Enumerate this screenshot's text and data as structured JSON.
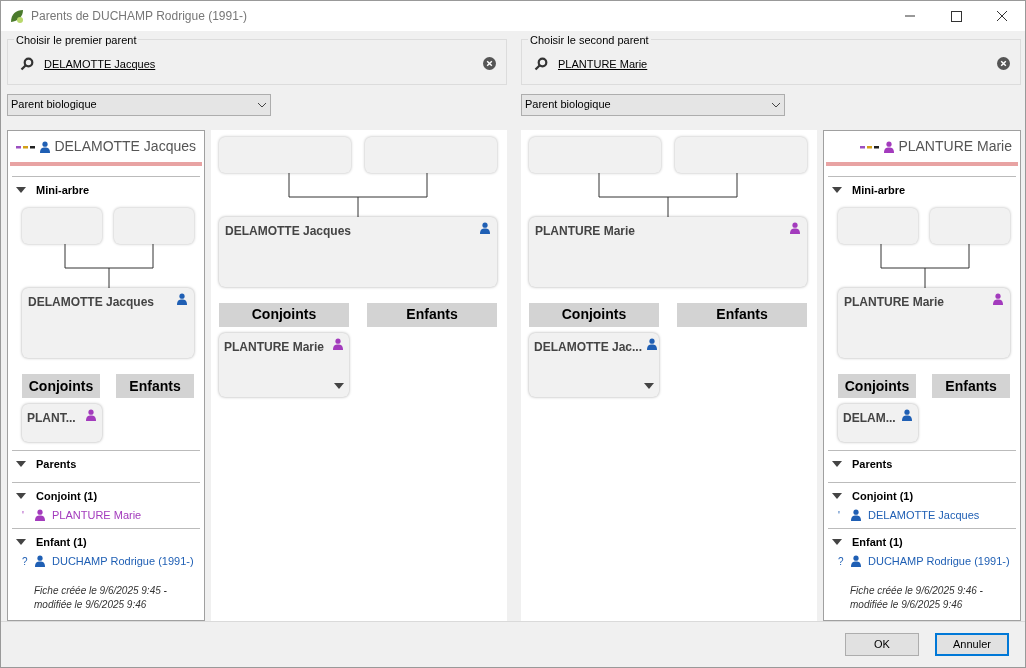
{
  "window": {
    "title": "Parents de DUCHAMP Rodrigue (1991-)"
  },
  "parents": [
    {
      "kind": "card-first",
      "chooser_label": "Choisir le premier parent",
      "selected_name": "DELAMOTTE Jacques",
      "relation": "Parent biologique",
      "tree": {
        "person": {
          "name": "DELAMOTTE Jacques",
          "color": "#1f5fb4"
        },
        "conjoints_label": "Conjoints",
        "enfants_label": "Enfants",
        "spouse": {
          "name": "PLANTURE Marie",
          "color": "#a33bbd"
        }
      },
      "card": {
        "name": "DELAMOTTE Jacques",
        "color": "#1f5fb4",
        "mini_tree_title": "Mini-arbre",
        "mini_tree": {
          "person": {
            "name": "DELAMOTTE Jacques",
            "color": "#1f5fb4"
          },
          "conjoints_label": "Conjoints",
          "enfants_label": "Enfants",
          "spouse": {
            "name": "PLANT...",
            "color": "#a33bbd"
          }
        },
        "parents_title": "Parents",
        "lists": [
          {
            "title": "Conjoint (1)",
            "items": [
              {
                "marker": "'",
                "name": "PLANTURE Marie",
                "color": "#a33bbd"
              }
            ]
          },
          {
            "title": "Enfant (1)",
            "items": [
              {
                "marker": "?",
                "name": "DUCHAMP Rodrigue (1991-)",
                "color": "#1f5fb4"
              }
            ]
          }
        ],
        "note": "Fiche créée le 9/6/2025 9:45 - modifiée le 9/6/2025 9:46"
      }
    },
    {
      "kind": "card-last",
      "chooser_label": "Choisir le second parent",
      "selected_name": "PLANTURE Marie",
      "relation": "Parent biologique",
      "tree": {
        "person": {
          "name": "PLANTURE Marie",
          "color": "#a33bbd"
        },
        "conjoints_label": "Conjoints",
        "enfants_label": "Enfants",
        "spouse": {
          "name": "DELAMOTTE Jac...",
          "color": "#1f5fb4"
        }
      },
      "card": {
        "name": "PLANTURE Marie",
        "color": "#a33bbd",
        "mini_tree_title": "Mini-arbre",
        "mini_tree": {
          "person": {
            "name": "PLANTURE Marie",
            "color": "#a33bbd"
          },
          "conjoints_label": "Conjoints",
          "enfants_label": "Enfants",
          "spouse": {
            "name": "DELAM...",
            "color": "#1f5fb4"
          }
        },
        "parents_title": "Parents",
        "lists": [
          {
            "title": "Conjoint (1)",
            "items": [
              {
                "marker": "'",
                "name": "DELAMOTTE Jacques",
                "color": "#1f5fb4"
              }
            ]
          },
          {
            "title": "Enfant (1)",
            "items": [
              {
                "marker": "?",
                "name": "DUCHAMP Rodrigue (1991-)",
                "color": "#1f5fb4"
              }
            ]
          }
        ],
        "note": "Fiche créée le 9/6/2025 9:46 - modifiée le 9/6/2025 9:46"
      }
    }
  ],
  "buttons": [
    {
      "label": "OK",
      "default": false
    },
    {
      "label": "Annuler",
      "default": true
    }
  ]
}
